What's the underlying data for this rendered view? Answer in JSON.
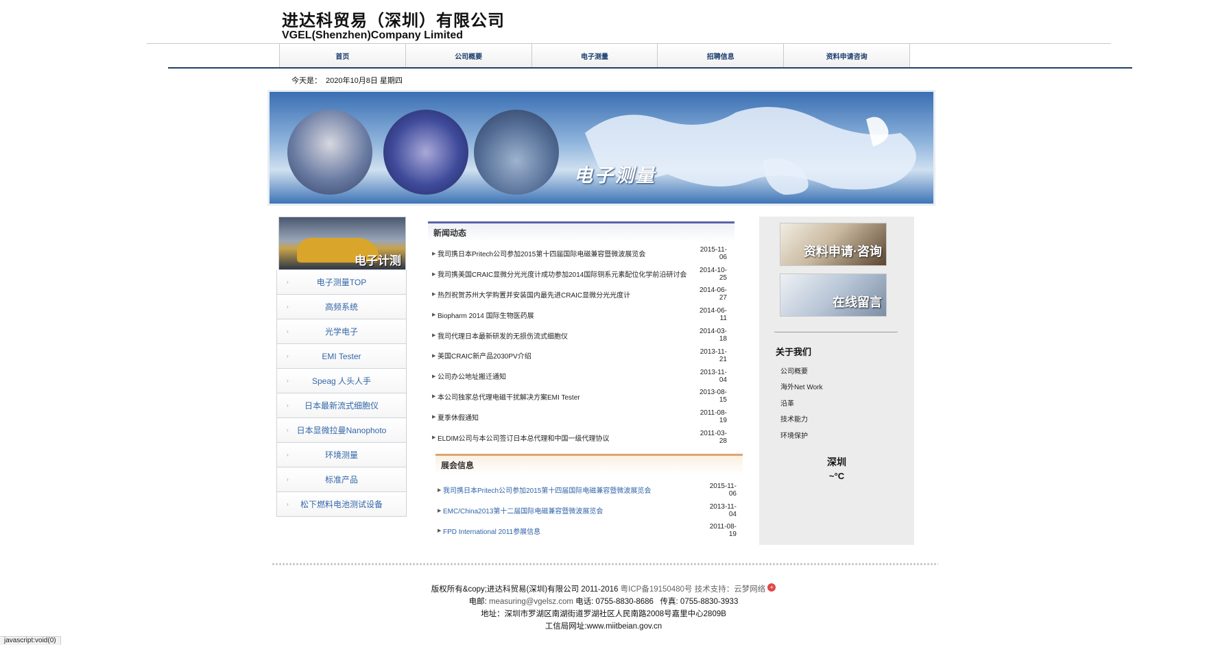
{
  "header": {
    "company_cn": "进达科贸易（深圳）有限公司",
    "company_en": "VGEL(Shenzhen)Company Limited"
  },
  "nav": [
    "首页",
    "公司概要",
    "电子测量",
    "招聘信息",
    "资料申请咨询"
  ],
  "date": {
    "label": "今天是：",
    "value": "2020年10月8日 星期四"
  },
  "banner": {
    "title": "电子测量"
  },
  "sidebar": {
    "photo_caption": "电子计测",
    "items": [
      "电子测量TOP",
      "高频系统",
      "光学电子",
      "EMI Tester",
      "Speag 人头人手",
      "日本最新流式细胞仪",
      "日本显微拉曼Nanophoto",
      "环境测量",
      "标准产品",
      "松下燃料电池测试设备"
    ]
  },
  "news": {
    "title": "新闻动态",
    "items": [
      {
        "title": "我司携日本Pritech公司参加2015第十四届国际电磁兼容暨微波展览会",
        "date": "2015-11-06"
      },
      {
        "title": "我司携美国CRAIC显微分光光度计成功参加2014国际铜系元素配位化学前沿研讨会",
        "date": "2014-10-25"
      },
      {
        "title": "热烈祝贺苏州大学购置并安装国内最先进CRAIC显微分光光度计",
        "date": "2014-06-27"
      },
      {
        "title": "Biopharm 2014 国际生物医药展",
        "date": "2014-06-11"
      },
      {
        "title": "我司代理日本最新研发的无损伤流式细胞仪",
        "date": "2014-03-18"
      },
      {
        "title": "美国CRAIC新产品2030PV介绍",
        "date": "2013-11-21"
      },
      {
        "title": "公司办公地址搬迁通知",
        "date": "2013-11-04"
      },
      {
        "title": "本公司独家总代理电磁干扰解决方案EMI Tester",
        "date": "2013-08-15"
      },
      {
        "title": "夏季休假通知",
        "date": "2011-08-19"
      },
      {
        "title": "ELDIM公司与本公司签订日本总代理和中国一级代理协议",
        "date": "2011-03-28"
      }
    ]
  },
  "expo": {
    "title": "展会信息",
    "items": [
      {
        "title": "我司携日本Pritech公司参加2015第十四届国际电磁兼容暨微波展览会",
        "date": "2015-11-06"
      },
      {
        "title": "EMC/China2013第十二届国际电磁兼容暨微波展览会",
        "date": "2013-11-04"
      },
      {
        "title": "FPD International 2011参展信息",
        "date": "2011-08-19"
      }
    ]
  },
  "right": {
    "btn_apply": "资料申请·咨询",
    "btn_message": "在线留言",
    "about_title": "关于我们",
    "about_items": [
      "公司概要",
      "海外Net Work",
      "沿革",
      "技术能力",
      "环境保护"
    ],
    "city": "深圳",
    "temp": "~°C"
  },
  "footer": {
    "copyright": "版权所有&copy;进达科贸易(深圳)有限公司  2011-2016",
    "icp": "粤ICP备19150480号",
    "support": "技术支持：云梦网络",
    "badge": "+",
    "email_label": "电邮:",
    "email": "measuring@vgelsz.com",
    "phone": "电话: 0755-8830-8686",
    "fax": "传真: 0755-8830-3933",
    "address": "地址：深圳市罗湖区南湖街道罗湖社区人民南路2008号嘉里中心2809B",
    "gov": "工信局网址:www.miitbeian.gov.cn"
  },
  "status_bar": "javascript:void(0)"
}
